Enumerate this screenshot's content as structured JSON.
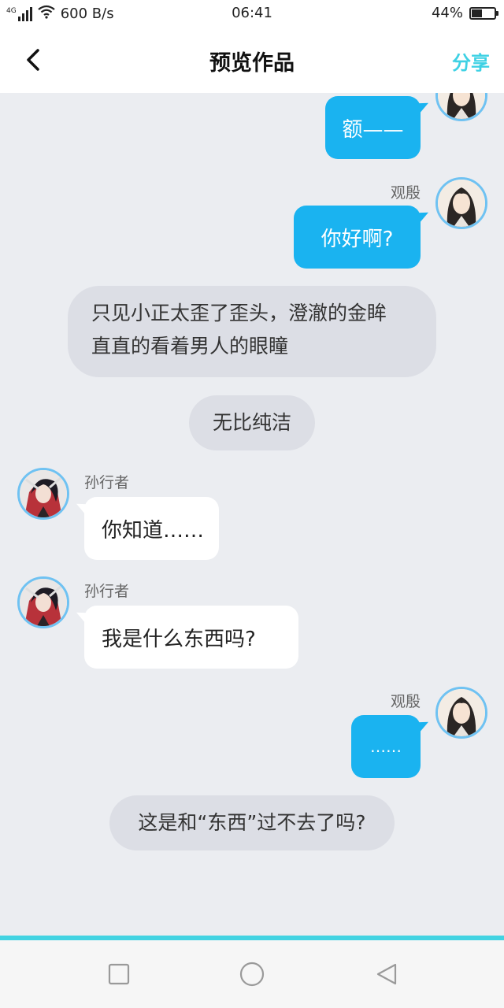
{
  "status_bar": {
    "network": "4G",
    "speed": "600 B/s",
    "time": "06:41",
    "battery": "44%",
    "battery_level": 0.44
  },
  "header": {
    "title": "预览作品",
    "share_label": "分享",
    "back_icon": "chevron-left-icon"
  },
  "messages": [
    {
      "type": "right",
      "speaker": "",
      "text": "额——"
    },
    {
      "type": "right",
      "speaker": "观殷",
      "text": "你好啊?"
    },
    {
      "type": "narration",
      "lines": [
        "只见小正太歪了歪头，澄澈的金眸",
        "直直的看着男人的眼瞳"
      ]
    },
    {
      "type": "narration",
      "text": "无比纯洁"
    },
    {
      "type": "left",
      "speaker": "孙行者",
      "text": "你知道……"
    },
    {
      "type": "left",
      "speaker": "孙行者",
      "text": "我是什么东西吗?"
    },
    {
      "type": "right",
      "speaker": "观殷",
      "text": "……"
    },
    {
      "type": "narration",
      "text": "这是和“东西”过不去了吗?"
    }
  ],
  "colors": {
    "right_bubble": "#1ab3f0",
    "left_bubble": "#ffffff",
    "narration": "#dcdee5",
    "background": "#ebedf1",
    "accent": "#42d3e2"
  },
  "nav_bar": {
    "icons": [
      "square-recents-icon",
      "circle-home-icon",
      "triangle-back-icon"
    ]
  }
}
